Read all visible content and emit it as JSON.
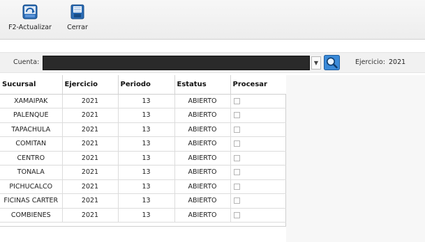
{
  "toolbar": {
    "refresh_label": "F2-Actualizar",
    "close_label": "Cerrar"
  },
  "filter": {
    "cuenta_label": "Cuenta:",
    "cuenta_value": "",
    "ejercicio_label": "Ejercicio:",
    "ejercicio_value": "2021"
  },
  "grid": {
    "columns": [
      "Sucursal",
      "Ejercicio",
      "Periodo",
      "Estatus",
      "Procesar"
    ],
    "rows": [
      {
        "sucursal": "XAMAIPAK",
        "ejercicio": "2021",
        "periodo": "13",
        "estatus": "ABIERTO",
        "procesar": false
      },
      {
        "sucursal": "PALENQUE",
        "ejercicio": "2021",
        "periodo": "13",
        "estatus": "ABIERTO",
        "procesar": false
      },
      {
        "sucursal": "TAPACHULA",
        "ejercicio": "2021",
        "periodo": "13",
        "estatus": "ABIERTO",
        "procesar": false
      },
      {
        "sucursal": "COMITAN",
        "ejercicio": "2021",
        "periodo": "13",
        "estatus": "ABIERTO",
        "procesar": false
      },
      {
        "sucursal": "CENTRO",
        "ejercicio": "2021",
        "periodo": "13",
        "estatus": "ABIERTO",
        "procesar": false
      },
      {
        "sucursal": "TONALA",
        "ejercicio": "2021",
        "periodo": "13",
        "estatus": "ABIERTO",
        "procesar": false
      },
      {
        "sucursal": "PICHUCALCO",
        "ejercicio": "2021",
        "periodo": "13",
        "estatus": "ABIERTO",
        "procesar": false
      },
      {
        "sucursal": "FICINAS CARTER",
        "ejercicio": "2021",
        "periodo": "13",
        "estatus": "ABIERTO",
        "procesar": false
      },
      {
        "sucursal": "COMBIENES",
        "ejercicio": "2021",
        "periodo": "13",
        "estatus": "ABIERTO",
        "procesar": false
      }
    ]
  },
  "icons": {
    "refresh": "refresh-icon",
    "close": "close-window-icon",
    "search": "search-icon",
    "dropdown": "chevron-down-icon"
  },
  "colors": {
    "icon_blue": "#1f5fa8",
    "search_blue": "#2f7fd0",
    "cuenta_field": "#2a2a2a"
  }
}
